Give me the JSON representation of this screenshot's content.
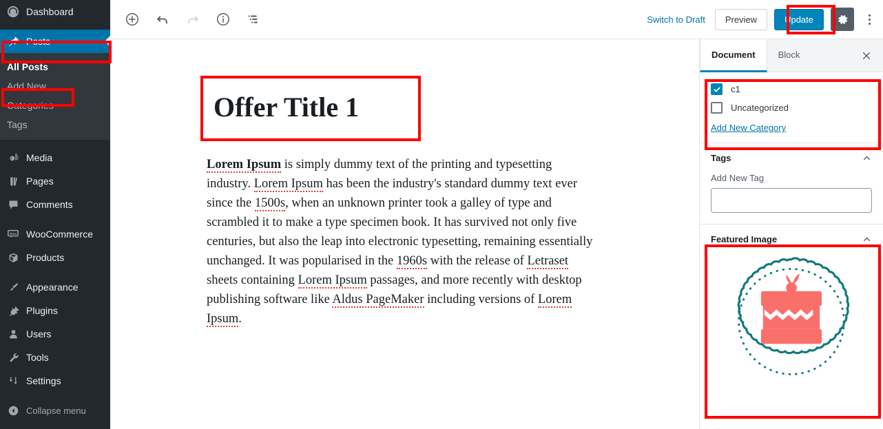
{
  "sidebar": {
    "items": [
      {
        "label": "Dashboard",
        "icon": "dashboard-icon",
        "active": false
      },
      {
        "label": "Posts",
        "icon": "pin-icon",
        "active": true
      },
      {
        "label": "Media",
        "icon": "media-icon",
        "active": false
      },
      {
        "label": "Pages",
        "icon": "pages-icon",
        "active": false
      },
      {
        "label": "Comments",
        "icon": "comments-icon",
        "active": false
      },
      {
        "label": "WooCommerce",
        "icon": "woocommerce-icon",
        "active": false
      },
      {
        "label": "Products",
        "icon": "products-box-icon",
        "active": false
      },
      {
        "label": "Appearance",
        "icon": "paintbrush-icon",
        "active": false
      },
      {
        "label": "Plugins",
        "icon": "plug-icon",
        "active": false
      },
      {
        "label": "Users",
        "icon": "user-icon",
        "active": false
      },
      {
        "label": "Tools",
        "icon": "wrench-icon",
        "active": false
      },
      {
        "label": "Settings",
        "icon": "sliders-icon",
        "active": false
      }
    ],
    "submenu": [
      {
        "label": "All Posts",
        "current": true
      },
      {
        "label": "Add New",
        "current": false
      },
      {
        "label": "Categories",
        "current": false
      },
      {
        "label": "Tags",
        "current": false
      }
    ],
    "collapse_label": "Collapse menu"
  },
  "toolbar": {
    "add_block_icon": "plus-circle-icon",
    "undo_icon": "undo-icon",
    "redo_icon": "redo-icon",
    "info_icon": "info-circle-icon",
    "list_view_icon": "list-view-icon",
    "switch_to_draft_label": "Switch to Draft",
    "preview_label": "Preview",
    "update_label": "Update",
    "settings_gear_icon": "gear-icon",
    "more_menu_icon": "kebab-menu-icon"
  },
  "editor": {
    "title": "Offer Title 1",
    "body_lines": [
      [
        {
          "t": "Lorem Ipsum",
          "b": true,
          "s": true
        },
        {
          "t": " is simply dummy text of the printing and typesetting"
        }
      ],
      [
        {
          "t": "industry. "
        },
        {
          "t": "Lorem Ipsum",
          "s": true
        },
        {
          "t": " has been the industry's standard dummy text ever"
        }
      ],
      [
        {
          "t": "since the "
        },
        {
          "t": "1500s",
          "s": true
        },
        {
          "t": ", when an unknown printer took a galley of type and"
        }
      ],
      [
        {
          "t": "scrambled it to make a type specimen book. It has survived not only five"
        }
      ],
      [
        {
          "t": "centuries, but also the leap into electronic typesetting, remaining essentially"
        }
      ],
      [
        {
          "t": "unchanged. It was popularised in the "
        },
        {
          "t": "1960s",
          "s": true
        },
        {
          "t": " with the release of "
        },
        {
          "t": "Letraset",
          "s": true
        }
      ],
      [
        {
          "t": "sheets containing "
        },
        {
          "t": "Lorem Ipsum",
          "s": true
        },
        {
          "t": " passages, and more recently with desktop"
        }
      ],
      [
        {
          "t": "publishing software like "
        },
        {
          "t": "Aldus PageMaker",
          "s": true
        },
        {
          "t": " including versions of "
        },
        {
          "t": "Lorem",
          "s": true
        }
      ],
      [
        {
          "t": "Ipsum",
          "s": true
        },
        {
          "t": "."
        }
      ]
    ]
  },
  "settings": {
    "tabs": [
      {
        "label": "Document",
        "active": true
      },
      {
        "label": "Block",
        "active": false
      }
    ],
    "close_icon": "close-icon",
    "categories": {
      "items": [
        {
          "label": "c1",
          "checked": true
        },
        {
          "label": "Uncategorized",
          "checked": false
        }
      ],
      "add_new_label": "Add New Category"
    },
    "tags": {
      "title": "Tags",
      "field_label": "Add New Tag",
      "input_value": "",
      "input_placeholder": "",
      "collapse_icon": "chevron-up-icon"
    },
    "featured_image": {
      "title": "Featured Image",
      "collapse_icon": "chevron-up-icon",
      "image_alt": "cake-illustration"
    }
  },
  "colors": {
    "admin_bg": "#23282d",
    "submenu_bg": "#32373c",
    "accent_blue": "#0073aa",
    "primary_button": "#0085ba",
    "annotation_red": "#ff0000",
    "cake_coral": "#f9706b",
    "badge_teal": "#11787d"
  }
}
